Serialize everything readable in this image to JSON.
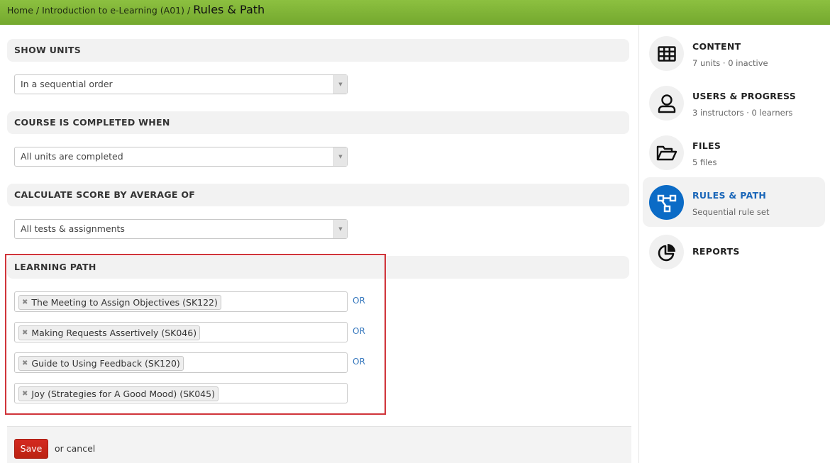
{
  "breadcrumb": {
    "items": [
      "Home",
      "Introduction to e-Learning (A01)"
    ],
    "separator": "/",
    "current": "Rules & Path"
  },
  "sections": {
    "show_units": {
      "title": "SHOW UNITS",
      "value": "In a sequential order"
    },
    "completed_when": {
      "title": "COURSE IS COMPLETED WHEN",
      "value": "All units are completed"
    },
    "score_average": {
      "title": "CALCULATE SCORE BY AVERAGE OF",
      "value": "All tests & assignments"
    },
    "learning_path": {
      "title": "LEARNING PATH",
      "remove_glyph": "✖",
      "or_label": "OR",
      "rows": [
        {
          "tag": "The Meeting to Assign Objectives (SK122)"
        },
        {
          "tag": "Making Requests Assertively (SK046)"
        },
        {
          "tag": "Guide to Using Feedback (SK120)"
        },
        {
          "tag": "Joy (Strategies for A Good Mood) (SK045)"
        }
      ]
    }
  },
  "footer": {
    "save_label": "Save",
    "cancel_label": "or cancel"
  },
  "sidebar": {
    "items": [
      {
        "title": "CONTENT",
        "subtitle": "7 units · 0 inactive",
        "icon": "grid-icon"
      },
      {
        "title": "USERS & PROGRESS",
        "subtitle": "3 instructors · 0 learners",
        "icon": "user-icon"
      },
      {
        "title": "FILES",
        "subtitle": "5 files",
        "icon": "folder-icon"
      },
      {
        "title": "RULES & PATH",
        "subtitle": "Sequential rule set",
        "icon": "rules-path-icon",
        "active": true
      },
      {
        "title": "REPORTS",
        "subtitle": "",
        "icon": "pie-chart-icon"
      }
    ]
  },
  "colors": {
    "header_green": "#8cc040",
    "active_blue": "#0b6bc6",
    "save_red": "#d42a20",
    "highlight_red": "#d0343a",
    "link_blue": "#3b7bbf"
  }
}
